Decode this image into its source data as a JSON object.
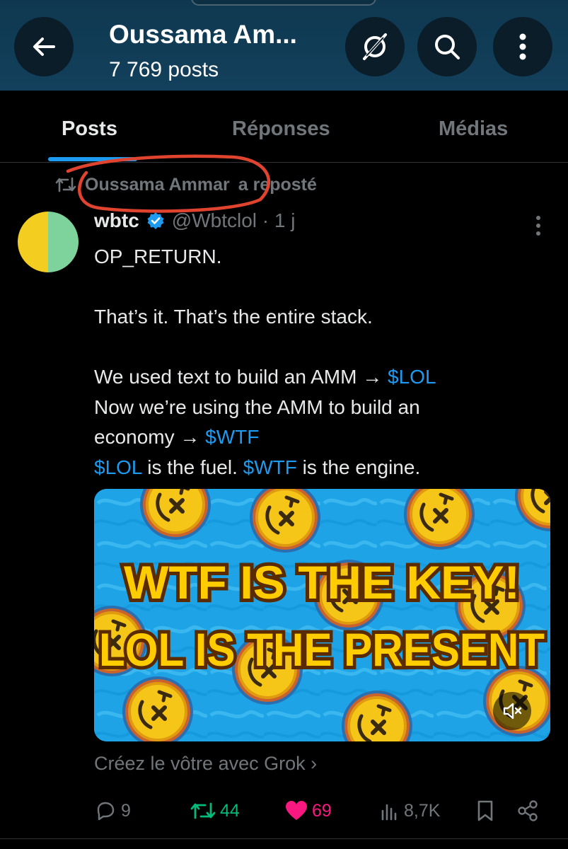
{
  "header": {
    "title": "Oussama Am...",
    "post_count": "7 769 posts",
    "bg_color": "#13405c"
  },
  "tabs": [
    {
      "label": "Posts",
      "active": true
    },
    {
      "label": "Réponses",
      "active": false
    },
    {
      "label": "Médias",
      "active": false
    }
  ],
  "accent_color": "#1d9bf0",
  "repost_banner": {
    "icon": "repost-icon",
    "name": "Oussama Ammar",
    "suffix": "a reposté",
    "annotation_color": "#e0442e"
  },
  "post": {
    "author_name": "wbtc",
    "verified": true,
    "handle_time": "@Wbtclol · 1 j",
    "lines": [
      {
        "pre": "OP_RETURN.",
        "tag": "",
        "post": ""
      },
      {
        "pre": "",
        "tag": "",
        "post": ""
      },
      {
        "pre": "That’s it. That’s the entire stack.",
        "tag": "",
        "post": ""
      },
      {
        "pre": "",
        "tag": "",
        "post": ""
      },
      {
        "pre": "We used text to build an AMM → ",
        "tag": "$LOL",
        "post": ""
      },
      {
        "pre": "Now we’re using the AMM to build an",
        "tag": "",
        "post": ""
      },
      {
        "pre": "economy → ",
        "tag": "$WTF",
        "post": ""
      },
      {
        "pre": "",
        "tag": "$LOL",
        "post": " is the fuel. "
      },
      {
        "pre": "",
        "tag": "$WTF",
        "post": " is the engine."
      }
    ],
    "media": {
      "line1": "WTF IS THE KEY!",
      "line2": "LOL IS THE PRESENT",
      "coin_text": "TX",
      "muted_icon": "volume-muted-icon"
    },
    "grok_link": "Créez le vôtre avec Grok ›",
    "stats": {
      "replies": "9",
      "reposts": "44",
      "likes": "69",
      "views": "8,7K"
    }
  }
}
